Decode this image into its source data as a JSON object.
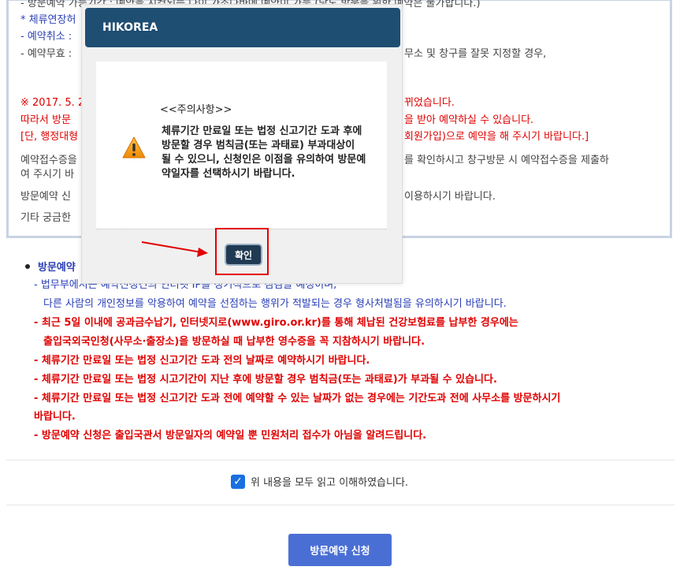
{
  "background": {
    "top_lines": [
      {
        "text": "- 방문예약 가능기간 : 예약을 지켰되는 다이 가조다바에 예약이 가능 (당도 방문을 위한 예약은 불가합니다.)",
        "color": "#444"
      },
      {
        "text": "* 체류연장허",
        "color": "#2a3fb6"
      },
      {
        "text": "- 예약취소 :",
        "color": "#2a3fb6"
      },
      {
        "text": "- 예약무효 :",
        "color": "#444"
      }
    ],
    "right_frag_1": "무소 및 창구를 잘못 지정할 경우,",
    "red_1_left": "※ 2017. 5. 2",
    "red_1_right": "뀌었습니다.",
    "red_2_left": "따라서 방문",
    "red_2_right": "을 받아 예약하실 수 있습니다.",
    "red_3_left": "[단, 행정대형",
    "red_3_right": "회원가입)으로 예약을 해 주시기 바랍니다.]",
    "gray_1_left": "예약접수증을",
    "gray_1_right": "를 확인하시고 창구방문 시 예약접수증을 제출하",
    "gray_2_left": "여 주시기 바",
    "gray_3_left": "방문예약 신",
    "gray_3_right": "이용하시기 바랍니다.",
    "gray_4_left": "기타 궁금한",
    "section_title": "방문예약",
    "list": [
      {
        "text": "- 법무부에서는 예약신청건의 인터넷 IP를 정기적으로 점검을 예정이며,",
        "color": "#2a3fb6",
        "bold": false
      },
      {
        "text": "다른 사람의 개인정보를 악용하여 예약을 선점하는 행위가 적발되는 경우 형사처벌됨을 유의하시기 바랍니다.",
        "color": "#2a3fb6",
        "bold": false,
        "indent": true
      },
      {
        "text": "- 최근 5일 이내에 공과금수납기, 인터넷지로(www.giro.or.kr)를 통해 체납된 건강보험료를 납부한 경우에는",
        "color": "#e00000",
        "bold": true
      },
      {
        "text": "출입국외국인청(사무소·출장소)을 방문하실 때 납부한 영수증을 꼭 지참하시기 바랍니다.",
        "color": "#e00000",
        "bold": true,
        "indent": true
      },
      {
        "text": "- 체류기간 만료일 또는 법정 신고기간 도과 전의 날짜로 예약하시기 바랍니다.",
        "color": "#e00000",
        "bold": true
      },
      {
        "text": "- 체류기간 만료일 또는 법정 시고기간이 지난 후에 방문할 경우 범칙금(또는 과태료)가 부과될 수 있습니다.",
        "color": "#e00000",
        "bold": true
      },
      {
        "text": "- 체류기간 만료일 또는 법정 신고기간 도과 전에 예약할 수 있는 날짜가 없는 경우에는 기간도과 전에 사무소를 방문하시기",
        "color": "#e00000",
        "bold": true
      },
      {
        "text": "바랍니다.",
        "color": "#e00000",
        "bold": true,
        "indent_small": true
      },
      {
        "text": "- 방문예약 신청은 출입국관서 방문일자의 예약일 뿐 민원처리 접수가 아님을 알려드립니다.",
        "color": "#e00000",
        "bold": true
      }
    ],
    "agree_label": "위 내용을 모두 읽고 이해하였습니다.",
    "agree_checked": true,
    "apply_button": "방문예약 신청"
  },
  "modal": {
    "title": "HIKOREA",
    "icon": "warning-icon",
    "heading": "<<주의사항>>",
    "message": "체류기간 만료일 또는 법정 신고기간 도과 후에 방문할 경우 범칙금(또는 과태료) 부과대상이 될 수 있으니, 신청인은 이점을 유의하여 방문예약일자를 선택하시기 바랍니다.",
    "confirm_button": "확인"
  },
  "colors": {
    "modal_header": "#1f4e73",
    "confirm_button": "#1f3a52",
    "apply_button": "#4a6fd4",
    "highlight": "#e50000"
  }
}
